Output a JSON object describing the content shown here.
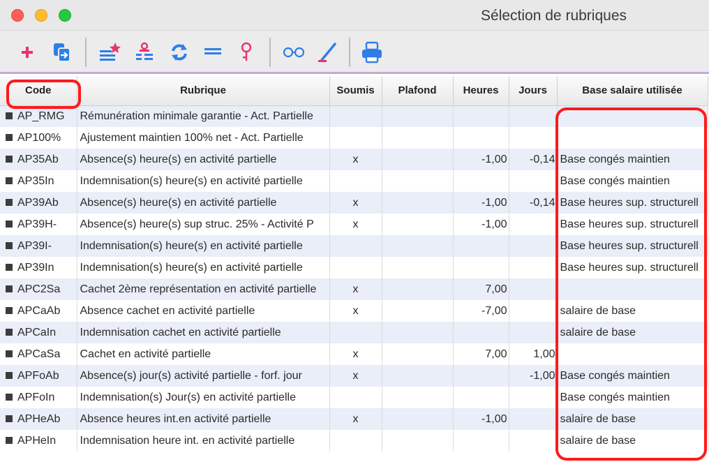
{
  "window": {
    "title": "Sélection de rubriques"
  },
  "toolbar": {
    "buttons": [
      {
        "icon": "add-icon"
      },
      {
        "icon": "export-icon"
      },
      {
        "icon": "list-star-icon"
      },
      {
        "icon": "list-user-icon"
      },
      {
        "icon": "refresh-icon"
      },
      {
        "icon": "equals-icon"
      },
      {
        "icon": "pin-icon"
      },
      {
        "icon": "glasses-icon"
      },
      {
        "icon": "pen-icon"
      },
      {
        "icon": "printer-icon"
      }
    ]
  },
  "table": {
    "headers": {
      "code": "Code",
      "rubrique": "Rubrique",
      "soumis": "Soumis",
      "plafond": "Plafond",
      "heures": "Heures",
      "jours": "Jours",
      "base": "Base salaire utilisée"
    },
    "rows": [
      {
        "code": "AP_RMG",
        "rubrique": "Rémunération minimale garantie - Act. Partielle",
        "soumis": "",
        "plafond": "",
        "heures": "",
        "jours": "",
        "base": ""
      },
      {
        "code": "AP100%",
        "rubrique": "Ajustement maintien 100% net - Act. Partielle",
        "soumis": "",
        "plafond": "",
        "heures": "",
        "jours": "",
        "base": ""
      },
      {
        "code": "AP35Ab",
        "rubrique": "Absence(s) heure(s) en activité partielle",
        "soumis": "x",
        "plafond": "",
        "heures": "-1,00",
        "jours": "-0,14",
        "base": "Base congés maintien"
      },
      {
        "code": "AP35In",
        "rubrique": "Indemnisation(s) heure(s) en activité partielle",
        "soumis": "",
        "plafond": "",
        "heures": "",
        "jours": "",
        "base": "Base congés maintien"
      },
      {
        "code": "AP39Ab",
        "rubrique": "Absence(s) heure(s) en activité partielle",
        "soumis": "x",
        "plafond": "",
        "heures": "-1,00",
        "jours": "-0,14",
        "base": "Base heures sup. structurell"
      },
      {
        "code": "AP39H-",
        "rubrique": "Absence(s) heure(s) sup struc. 25% - Activité P",
        "soumis": "x",
        "plafond": "",
        "heures": "-1,00",
        "jours": "",
        "base": "Base heures sup. structurell"
      },
      {
        "code": "AP39I-",
        "rubrique": "Indemnisation(s) heure(s) en activité partielle",
        "soumis": "",
        "plafond": "",
        "heures": "",
        "jours": "",
        "base": "Base heures sup. structurell"
      },
      {
        "code": "AP39In",
        "rubrique": "Indemnisation(s) heure(s) en activité partielle",
        "soumis": "",
        "plafond": "",
        "heures": "",
        "jours": "",
        "base": "Base heures sup. structurell"
      },
      {
        "code": "APC2Sa",
        "rubrique": "Cachet 2ème représentation en activité partielle",
        "soumis": "x",
        "plafond": "",
        "heures": "7,00",
        "jours": "",
        "base": ""
      },
      {
        "code": "APCaAb",
        "rubrique": "Absence cachet en activité partielle",
        "soumis": "x",
        "plafond": "",
        "heures": "-7,00",
        "jours": "",
        "base": "salaire de base"
      },
      {
        "code": "APCaIn",
        "rubrique": "Indemnisation cachet en activité partielle",
        "soumis": "",
        "plafond": "",
        "heures": "",
        "jours": "",
        "base": "salaire de base"
      },
      {
        "code": "APCaSa",
        "rubrique": "Cachet en activité partielle",
        "soumis": "x",
        "plafond": "",
        "heures": "7,00",
        "jours": "1,00",
        "base": ""
      },
      {
        "code": "APFoAb",
        "rubrique": "Absence(s) jour(s) activité partielle - forf. jour",
        "soumis": "x",
        "plafond": "",
        "heures": "",
        "jours": "-1,00",
        "base": "Base congés maintien"
      },
      {
        "code": "APFoIn",
        "rubrique": "Indemnisation(s) Jour(s) en activité partielle",
        "soumis": "",
        "plafond": "",
        "heures": "",
        "jours": "",
        "base": "Base congés maintien"
      },
      {
        "code": "APHeAb",
        "rubrique": "Absence heures int.en activité partielle",
        "soumis": "x",
        "plafond": "",
        "heures": "-1,00",
        "jours": "",
        "base": "salaire de base"
      },
      {
        "code": "APHeIn",
        "rubrique": "Indemnisation heure int. en activité partielle",
        "soumis": "",
        "plafond": "",
        "heures": "",
        "jours": "",
        "base": "salaire de base"
      }
    ]
  },
  "colors": {
    "highlight": "#ff1a1a",
    "row_alt": "#e9eef8",
    "icon_blue": "#2f7ee8",
    "icon_pink": "#e8336d",
    "toolbar_accent": "#c7a7d8"
  }
}
